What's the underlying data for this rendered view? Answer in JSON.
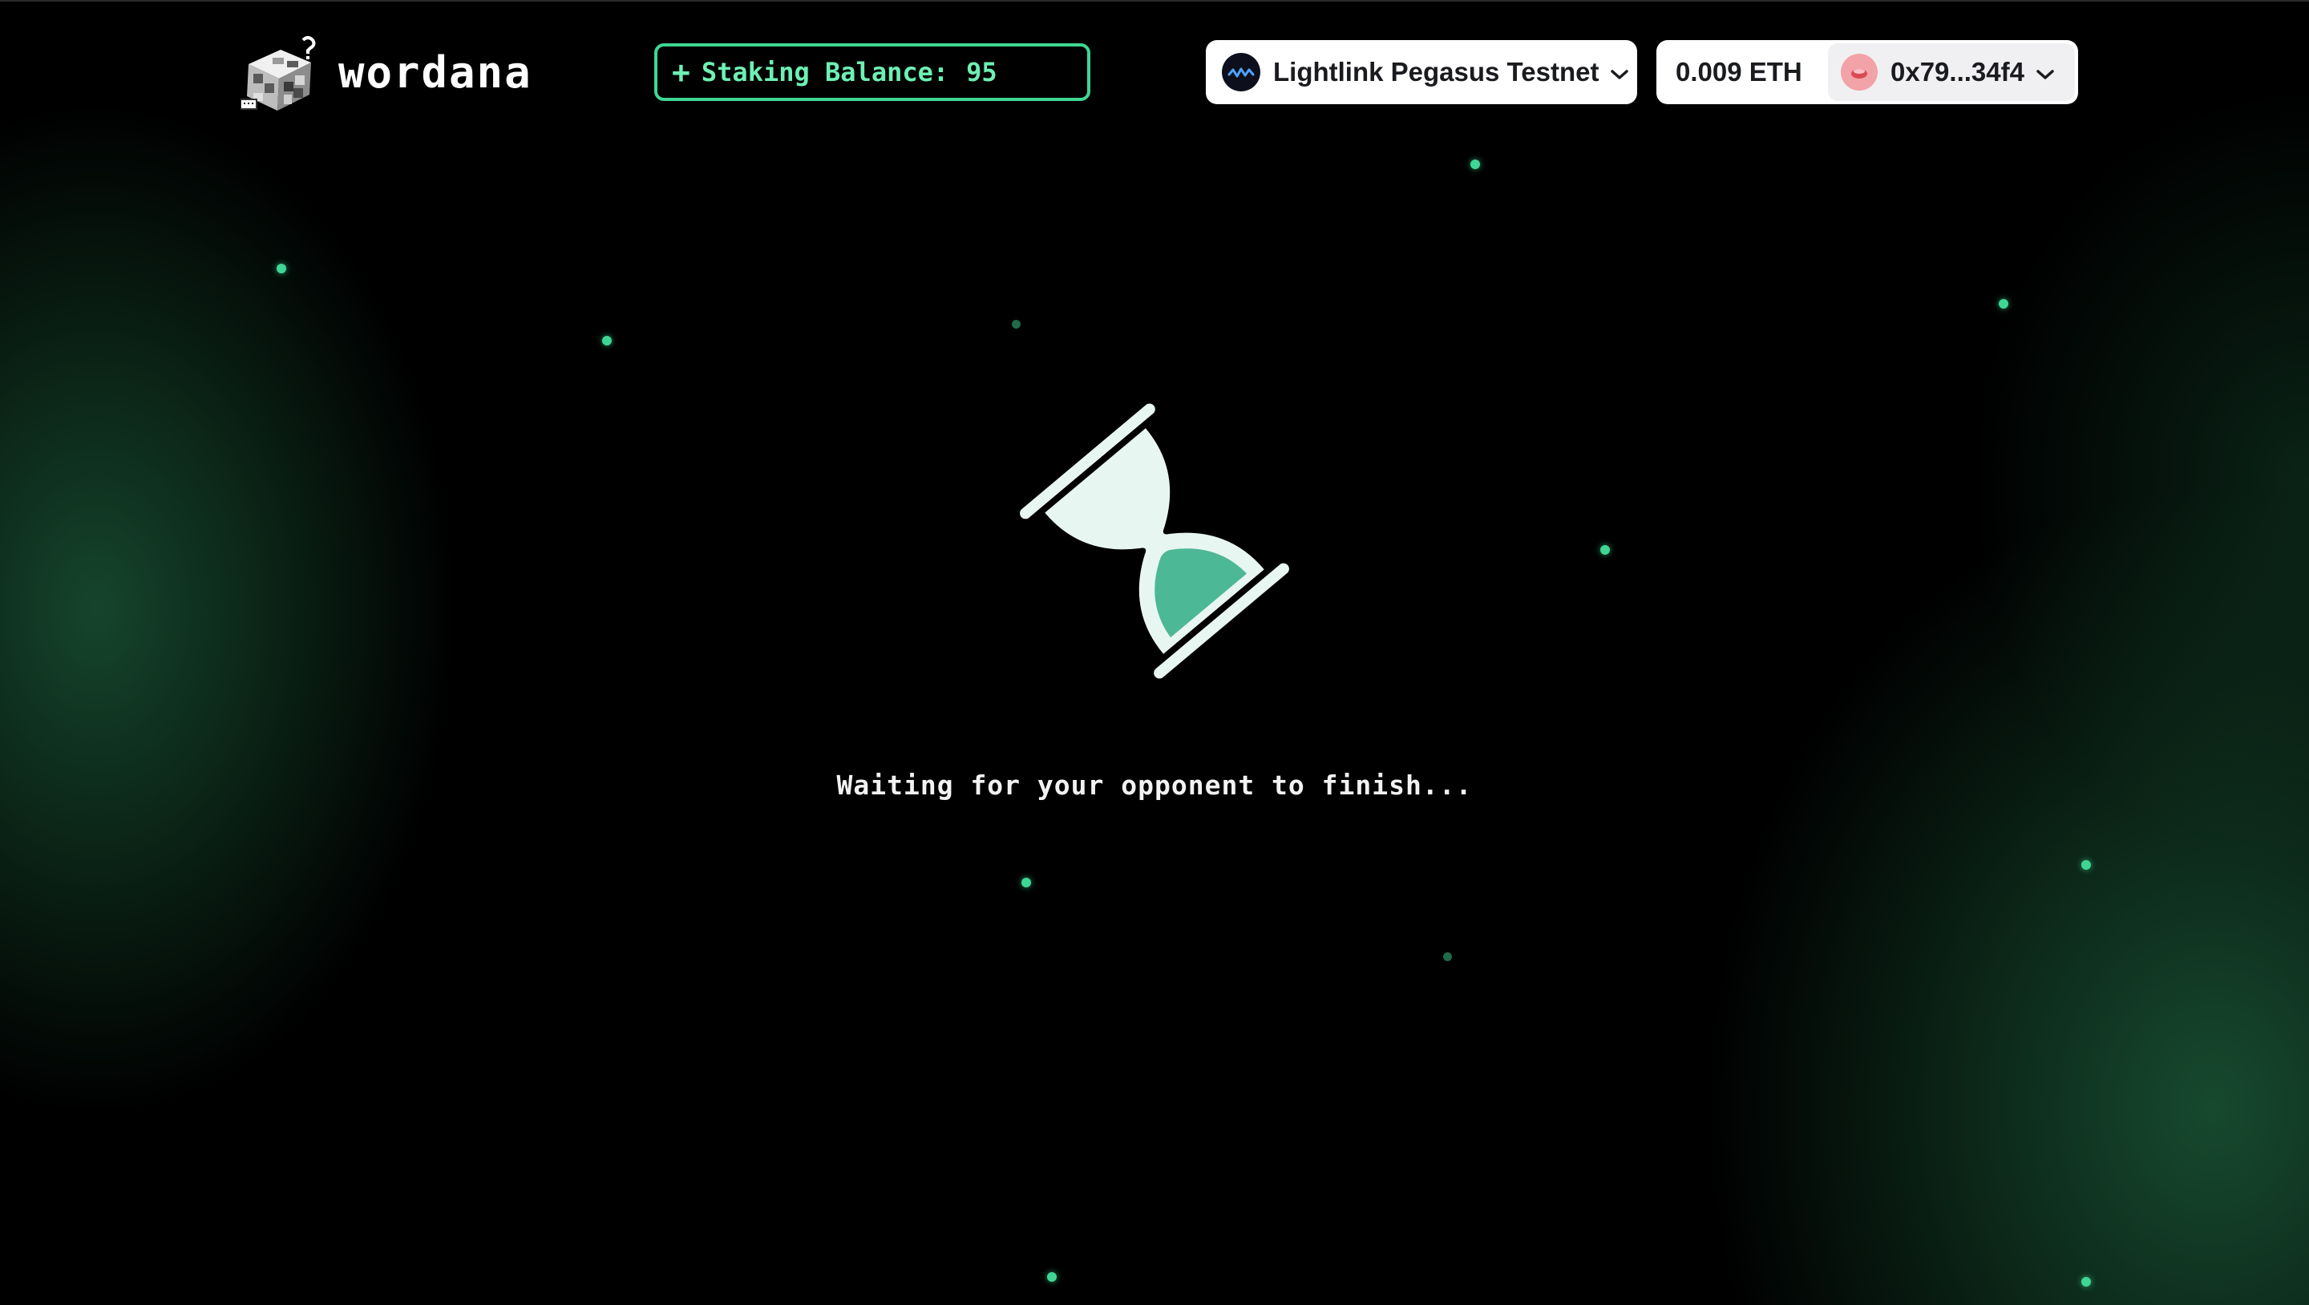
{
  "header": {
    "logo_text": "wordana",
    "logo_icon": "cube-question-icon",
    "staking": {
      "label": "Staking Balance:",
      "amount": "95",
      "icon": "plus-icon"
    },
    "network": {
      "name": "Lightlink Pegasus Testnet",
      "icon": "lightlink-network-icon"
    },
    "account": {
      "balance": "0.009 ETH",
      "address": "0x79...34f4",
      "avatar_icon": "avatar-icon"
    }
  },
  "main": {
    "status_icon": "hourglass-icon",
    "status_text": "Waiting for your opponent to finish..."
  },
  "colors": {
    "accent": "#3fd694",
    "accent_text": "#6df0b4",
    "background": "#000000",
    "sand": "#4db896",
    "glass": "#e8f6f1"
  }
}
